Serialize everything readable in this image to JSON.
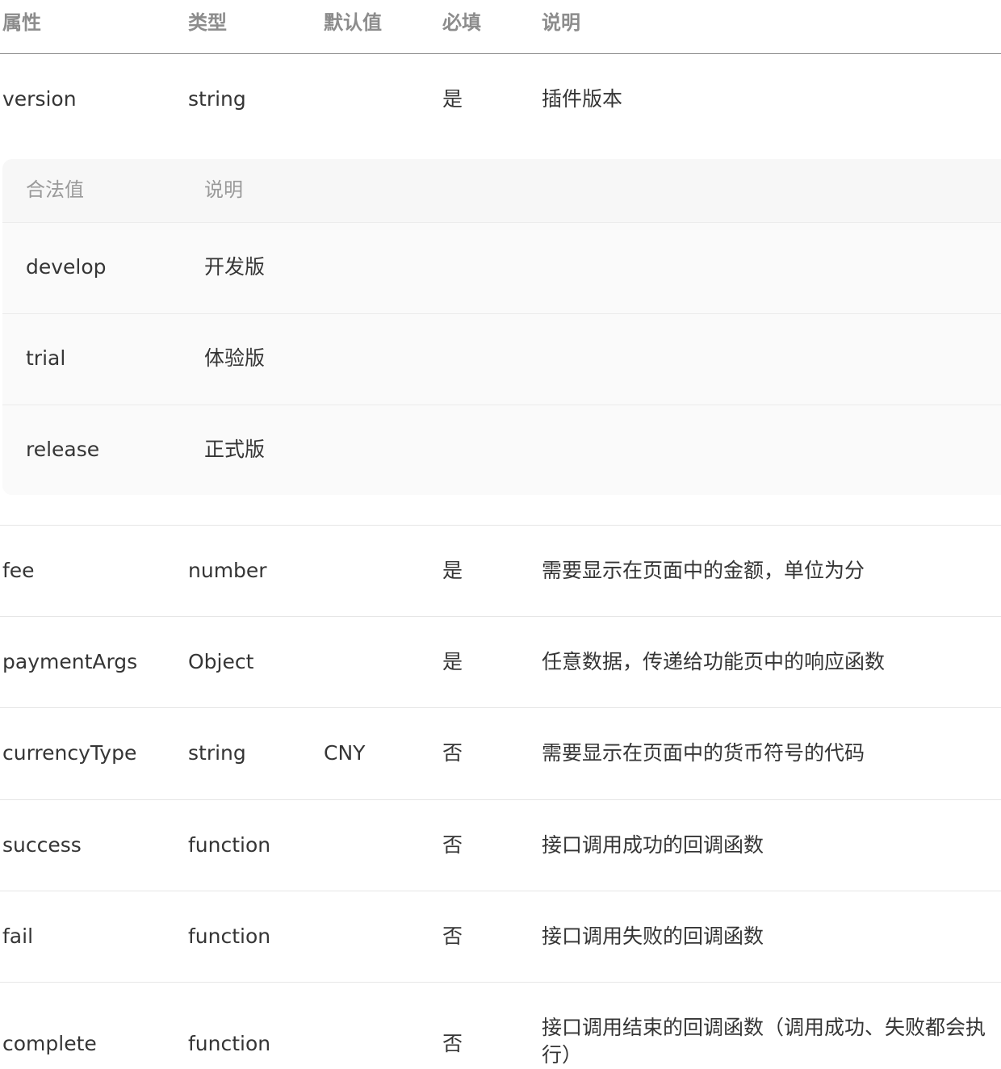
{
  "header": {
    "attr": "属性",
    "type": "类型",
    "default": "默认值",
    "required": "必填",
    "desc": "说明"
  },
  "rows": [
    {
      "attr": "version",
      "type": "string",
      "default": "",
      "required": "是",
      "desc": "插件版本"
    },
    {
      "attr": "fee",
      "type": "number",
      "default": "",
      "required": "是",
      "desc": "需要显示在页面中的金额，单位为分"
    },
    {
      "attr": "paymentArgs",
      "type": "Object",
      "default": "",
      "required": "是",
      "desc": "任意数据，传递给功能页中的响应函数"
    },
    {
      "attr": "currencyType",
      "type": "string",
      "default": "CNY",
      "required": "否",
      "desc": "需要显示在页面中的货币符号的代码"
    },
    {
      "attr": "success",
      "type": "function",
      "default": "",
      "required": "否",
      "desc": "接口调用成功的回调函数"
    },
    {
      "attr": "fail",
      "type": "function",
      "default": "",
      "required": "否",
      "desc": "接口调用失败的回调函数"
    },
    {
      "attr": "complete",
      "type": "function",
      "default": "",
      "required": "否",
      "desc": "接口调用结束的回调函数（调用成功、失败都会执行）"
    }
  ],
  "version_values": {
    "header": {
      "value": "合法值",
      "desc": "说明"
    },
    "items": [
      {
        "value": "develop",
        "desc": "开发版"
      },
      {
        "value": "trial",
        "desc": "体验版"
      },
      {
        "value": "release",
        "desc": "正式版"
      }
    ]
  }
}
